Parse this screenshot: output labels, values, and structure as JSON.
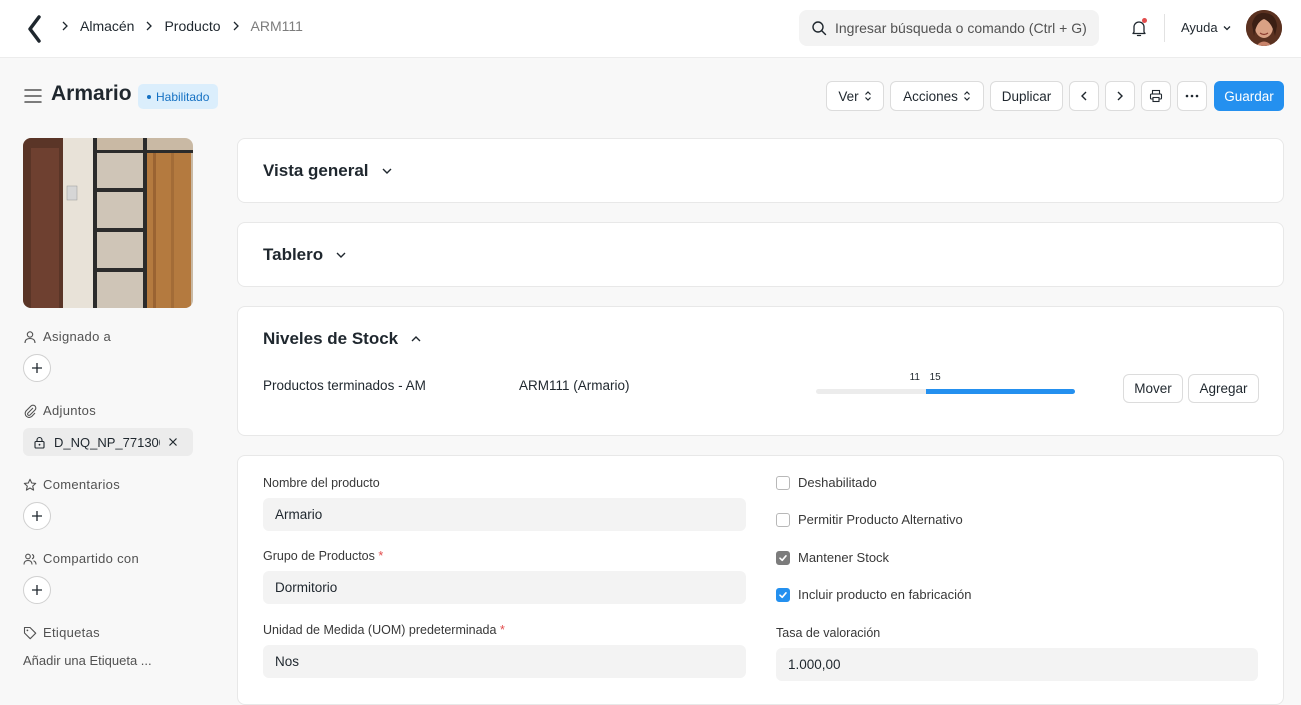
{
  "breadcrumb": [
    "Almacén",
    "Producto",
    "ARM111"
  ],
  "search": {
    "placeholder": "Ingresar búsqueda o comando (Ctrl + G)"
  },
  "nav": {
    "help": "Ayuda"
  },
  "page": {
    "title": "Armario",
    "status": "Habilitado"
  },
  "toolbar": {
    "view": "Ver",
    "actions": "Acciones",
    "duplicate": "Duplicar",
    "save": "Guardar"
  },
  "sidebar": {
    "assigned": "Asignado a",
    "attachments": "Adjuntos",
    "attachment_file": "D_NQ_NP_771300",
    "comments": "Comentarios",
    "shared": "Compartido con",
    "tags": "Etiquetas",
    "add_tag": "Añadir una Etiqueta ..."
  },
  "sections": {
    "overview": "Vista general",
    "dashboard": "Tablero",
    "stock_levels": "Niveles de Stock"
  },
  "stock": {
    "warehouse": "Productos terminados - AM",
    "item": "ARM111 (Armario)",
    "label_left": "11",
    "label_right": "15",
    "scale_max": 26,
    "move": "Mover",
    "add": "Agregar"
  },
  "form": {
    "item_name_label": "Nombre del producto",
    "item_name": "Armario",
    "item_group_label": "Grupo de Productos",
    "item_group": "Dormitorio",
    "uom_label": "Unidad de Medida (UOM) predeterminada",
    "uom": "Nos",
    "disabled_label": "Deshabilitado",
    "allow_alt_label": "Permitir Producto Alternativo",
    "maintain_stock_label": "Mantener Stock",
    "include_mfg_label": "Incluir producto en fabricación",
    "valuation_label": "Tasa de valoración",
    "valuation": "1.000,00",
    "disabled": false,
    "allow_alt": false,
    "maintain_stock": true,
    "include_mfg": true
  },
  "colors": {
    "primary": "#2490ef",
    "badge_bg": "#dbeefc",
    "badge_text": "#1571c3"
  }
}
